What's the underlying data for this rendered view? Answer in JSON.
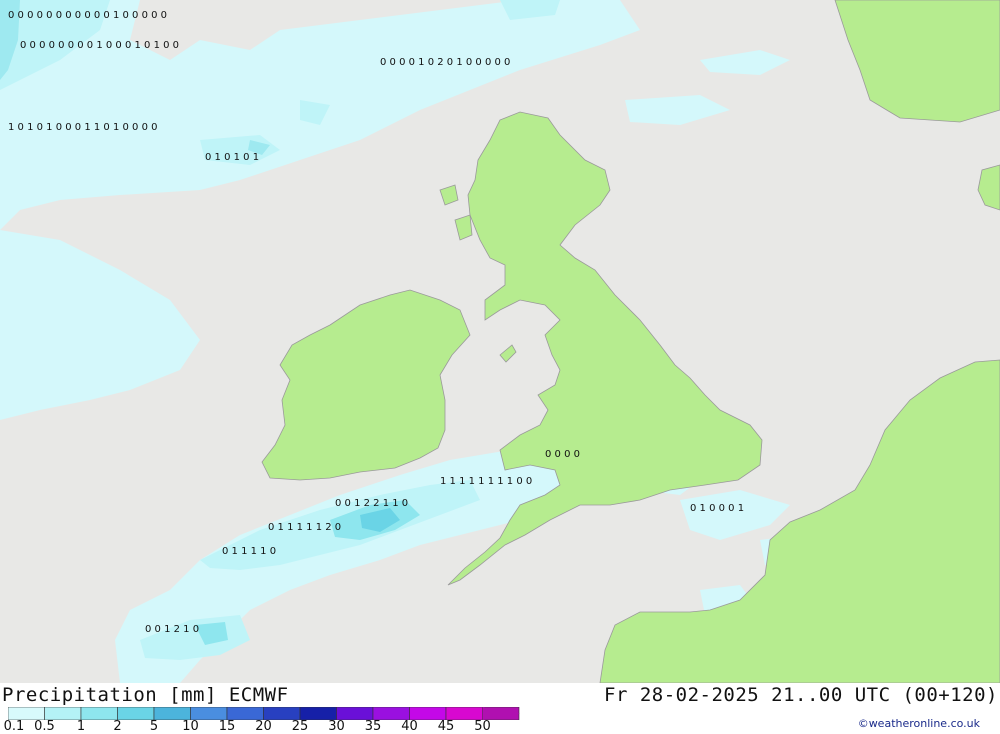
{
  "title": "Precipitation [mm] ECMWF",
  "datetime": "Fr 28-02-2025 21..00 UTC (00+120)",
  "credit": "©weatheronline.co.uk",
  "colors": {
    "sea": "#e8e8e6",
    "land": "#b6ec8f",
    "border": "#9a9a9a"
  },
  "legend": {
    "ticks": [
      "0.1",
      "0.5",
      "1",
      "2",
      "5",
      "10",
      "15",
      "20",
      "25",
      "30",
      "35",
      "40",
      "45",
      "50"
    ],
    "swatches": [
      "#d8fafc",
      "#b4f2f6",
      "#8ee6ee",
      "#6ad4e6",
      "#4cb4dc",
      "#4a8ee0",
      "#3a68d6",
      "#2840c0",
      "#1620a8",
      "#6a10d8",
      "#9a10e0",
      "#c408e8",
      "#d808d0",
      "#b010b0"
    ]
  },
  "values": {
    "row_a": "0 0 0 0 0 0 0 0 0 0 0 1 0 0 0 0 0",
    "row_b": "0 0 0 0 0 0 0 0 1 0 0 0 1 0 1 0 0",
    "row_c": "0 0 0 0 1 0 2 0 1 0 0 0 0 0",
    "row_d": "1 0 1 0 1 0 0 0 1 1 0 1 0 0 0 0",
    "row_e": "0 1 0 1 0 1",
    "row_f": "1 1 1 1 1 1 1 1 0 0",
    "row_g": "0 0 1 2 2 1 1 0",
    "row_h": "0 1 1 1 1 1 2 0",
    "row_i": "0 1 1 1 1 0",
    "row_j": "0 0 1 2 1 0",
    "row_k": "0 0 0 0",
    "row_l": "0 1 0 0 0 1"
  }
}
